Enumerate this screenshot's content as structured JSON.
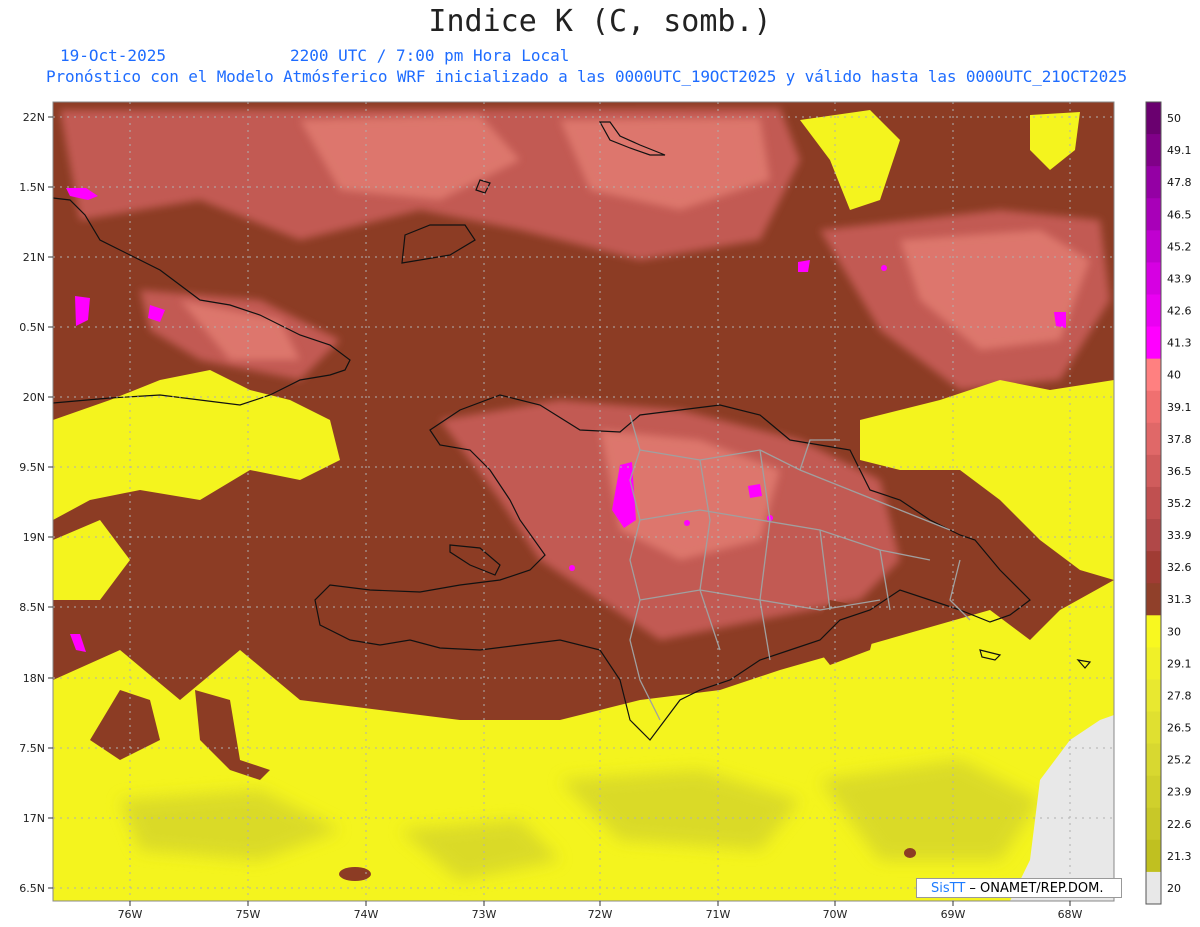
{
  "header": {
    "title": "Indice K (C, somb.)",
    "date": "19-Oct-2025",
    "time": "2200 UTC / 7:00 pm Hora Local",
    "forecast_line": "Pronóstico con el Modelo Atmósferico WRF inicializado a las 0000UTC_19OCT2025 y válido hasta las  0000UTC_21OCT2025"
  },
  "axes": {
    "lon_ticks": [
      "76W",
      "75W",
      "74W",
      "73W",
      "72W",
      "71W",
      "70W",
      "69W",
      "68W"
    ],
    "lat_ticks": [
      "22N",
      "1.5N",
      "21N",
      "0.5N",
      "20N",
      "9.5N",
      "19N",
      "8.5N",
      "18N",
      "7.5N",
      "17N",
      "6.5N"
    ]
  },
  "colorbar": {
    "labels": [
      "50",
      "49.1",
      "47.8",
      "46.5",
      "45.2",
      "43.9",
      "42.6",
      "41.3",
      "40",
      "39.1",
      "37.8",
      "36.5",
      "35.2",
      "33.9",
      "32.6",
      "31.3",
      "30",
      "29.1",
      "27.8",
      "26.5",
      "25.2",
      "23.9",
      "22.6",
      "21.3",
      "20"
    ],
    "colors": [
      "#6a006f",
      "#800088",
      "#9400a4",
      "#a800b8",
      "#c000d0",
      "#d600e2",
      "#ea00f2",
      "#ff00ff",
      "#ff8080",
      "#f07070",
      "#e06868",
      "#d05c5c",
      "#c05050",
      "#b04848",
      "#a03c34",
      "#90402a",
      "#f8f820",
      "#f0f028",
      "#e8e830",
      "#e0e030",
      "#d8d830",
      "#d0d02c",
      "#c8c828",
      "#c0c020",
      "#e8e8e8"
    ]
  },
  "credit": {
    "logo": "SisTT",
    "text": " – ONAMET/REP.DOM."
  },
  "colors": {
    "dark_brown": "#8c3c24",
    "salmon": "#c86058",
    "light_salmon": "#e07870",
    "yellow": "#f4f420",
    "olive_yellow": "#d8d830",
    "magenta": "#ff00ff",
    "border_gray": "#a0a0a0"
  }
}
